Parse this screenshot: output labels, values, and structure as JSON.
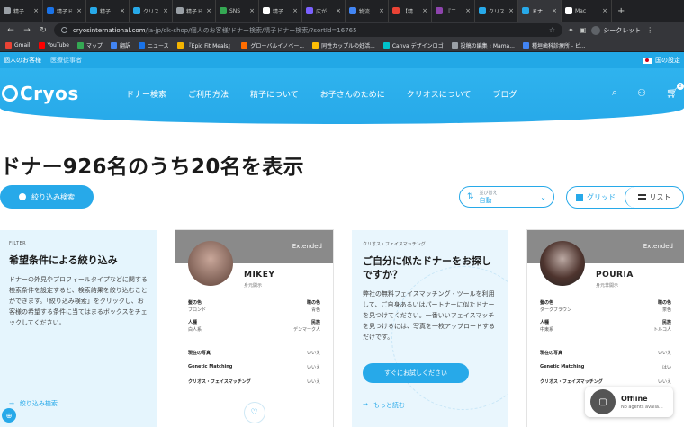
{
  "browser": {
    "tabs": [
      {
        "label": "精子",
        "color": "#9aa0a6"
      },
      {
        "label": "精子ド",
        "color": "#1a73e8"
      },
      {
        "label": "精子",
        "color": "#27a9e9"
      },
      {
        "label": "クリス",
        "color": "#27a9e9"
      },
      {
        "label": "精子ド",
        "color": "#9aa0a6"
      },
      {
        "label": "SNS",
        "color": "#34a853"
      },
      {
        "label": "精子",
        "color": "#ffffff"
      },
      {
        "label": "広が",
        "color": "#7b61ff"
      },
      {
        "label": "物流",
        "color": "#4285f4"
      },
      {
        "label": "【精",
        "color": "#ea4335"
      },
      {
        "label": "『二",
        "color": "#8e44ad"
      },
      {
        "label": "クリス",
        "color": "#27a9e9"
      },
      {
        "label": "ドナ",
        "color": "#27a9e9"
      },
      {
        "label": "Mac",
        "color": "#ffffff"
      }
    ],
    "new_tab": "+",
    "url_host": "cryosinternational.com",
    "url_path": "/ja-jp/dk-shop/個人のお客様/ドナー検索/精子ドナー検索/?sortId=16765",
    "incognito_label": "シークレット",
    "bookmarks": [
      {
        "label": "Gmail",
        "color": "#ea4335"
      },
      {
        "label": "YouTube",
        "color": "#ff0000"
      },
      {
        "label": "マップ",
        "color": "#34a853"
      },
      {
        "label": "翻訳",
        "color": "#4285f4"
      },
      {
        "label": "ニュース",
        "color": "#1a73e8"
      },
      {
        "label": "『Epic Fit Meals』",
        "color": "#f4b400"
      },
      {
        "label": "グローバルイノベー...",
        "color": "#ff6d00"
      },
      {
        "label": "同性カップルの妊活...",
        "color": "#fbbc05"
      },
      {
        "label": "Canva デザインロゴ",
        "color": "#00c4cc"
      },
      {
        "label": "投稿の編集 ‹ Mama...",
        "color": "#9aa0a6"
      },
      {
        "label": "種垣歯科診療所 - ピ...",
        "color": "#4285f4"
      }
    ]
  },
  "site": {
    "util_personal": "個人のお客様",
    "util_medical": "医療従事者",
    "lang_label": "国の設定",
    "logo": "Cryos",
    "nav": [
      "ドナー検索",
      "ご利用方法",
      "精子について",
      "お子さんのために",
      "クリオスについて",
      "ブログ"
    ],
    "cart_count": "2"
  },
  "main": {
    "title": "ドナー926名のうち20名を表示",
    "filter_button": "絞り込み検索",
    "sort_small": "並び替え",
    "sort_value": "自動",
    "view_grid": "グリッド",
    "view_list": "リスト"
  },
  "filter_card": {
    "tag": "FILTER",
    "head": "希望条件による絞り込み",
    "body": "ドナーの外見やプロフィールタイプなどに関する検索条件を設定すると、検索結果を絞り込むことができます。「絞り込み検索」をクリックし、お客様の希望する条件に当てはまるボックスをチェックしてください。",
    "link": "絞り込み検索"
  },
  "donors": [
    {
      "badge": "Extended",
      "name": "MIKEY",
      "id_status": "身元開示",
      "hair_label": "髪の色",
      "hair": "ブロンド",
      "eye_label": "瞳の色",
      "eye": "青色",
      "race_label": "人種",
      "race": "白人系",
      "ethnic_label": "民族",
      "ethnic": "デンマーク人",
      "photo_label": "現在の写真",
      "photo": "いいえ",
      "genetic_label": "Genetic Matching",
      "genetic": "いいえ",
      "face_label": "クリオス・フェイスマッチング",
      "face": "いいえ"
    },
    {
      "badge": "Extended",
      "name": "POURIA",
      "id_status": "身元非開示",
      "hair_label": "髪の色",
      "hair": "ダークブラウン",
      "eye_label": "瞳の色",
      "eye": "茶色",
      "race_label": "人種",
      "race": "中東系",
      "ethnic_label": "民族",
      "ethnic": "トルコ人",
      "photo_label": "現在の写真",
      "photo": "いいえ",
      "genetic_label": "Genetic Matching",
      "genetic": "はい",
      "face_label": "クリオス・フェイスマッチング",
      "face": "いいえ"
    }
  ],
  "face_card": {
    "tag": "クリオス・フェイスマッチング",
    "head": "ご自分に似たドナーをお探しですか？",
    "body": "弊社の無料フェイスマッチング・ツールを利用して、ご自身あるいはパートナーに似たドナーを見つけてください。一番いいフェイスマッチを見つけるには、写真を一枚アップロードするだけです。",
    "cta": "すぐにお試しください",
    "more": "もっと読む"
  },
  "chat": {
    "title": "Offline",
    "subtitle": "No agents availa..."
  },
  "colors": {
    "brand": "#27a9e9",
    "extended_band": "#8a8a8a"
  }
}
